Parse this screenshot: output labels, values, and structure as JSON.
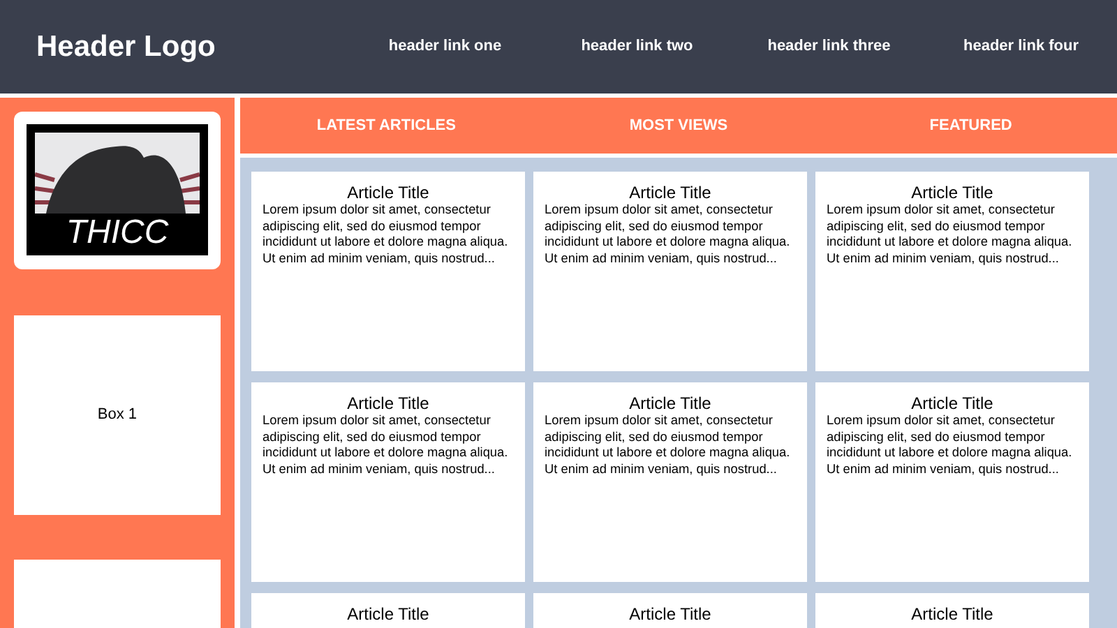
{
  "header": {
    "logo": "Header Logo",
    "links": [
      "header link one",
      "header link two",
      "header link three",
      "header link four"
    ]
  },
  "sidebar": {
    "logo_caption": "THICC",
    "boxes": [
      {
        "label": "Box 1"
      }
    ]
  },
  "tabs": [
    "LATEST ARTICLES",
    "MOST VIEWS",
    "FEATURED"
  ],
  "articles": [
    {
      "title": "Article Title",
      "excerpt": "Lorem ipsum dolor sit amet, consectetur adipiscing elit, sed do eiusmod tempor incididunt ut labore et dolore magna aliqua. Ut enim ad minim veniam, quis nostrud..."
    },
    {
      "title": "Article Title",
      "excerpt": "Lorem ipsum dolor sit amet, consectetur adipiscing elit, sed do eiusmod tempor incididunt ut labore et dolore magna aliqua. Ut enim ad minim veniam, quis nostrud..."
    },
    {
      "title": "Article Title",
      "excerpt": "Lorem ipsum dolor sit amet, consectetur adipiscing elit, sed do eiusmod tempor incididunt ut labore et dolore magna aliqua. Ut enim ad minim veniam, quis nostrud..."
    },
    {
      "title": "Article Title",
      "excerpt": "Lorem ipsum dolor sit amet, consectetur adipiscing elit, sed do eiusmod tempor incididunt ut labore et dolore magna aliqua. Ut enim ad minim veniam, quis nostrud..."
    },
    {
      "title": "Article Title",
      "excerpt": "Lorem ipsum dolor sit amet, consectetur adipiscing elit, sed do eiusmod tempor incididunt ut labore et dolore magna aliqua. Ut enim ad minim veniam, quis nostrud..."
    },
    {
      "title": "Article Title",
      "excerpt": "Lorem ipsum dolor sit amet, consectetur adipiscing elit, sed do eiusmod tempor incididunt ut labore et dolore magna aliqua. Ut enim ad minim veniam, quis nostrud..."
    },
    {
      "title": "Article Title"
    },
    {
      "title": "Article Title"
    },
    {
      "title": "Article Title"
    }
  ]
}
